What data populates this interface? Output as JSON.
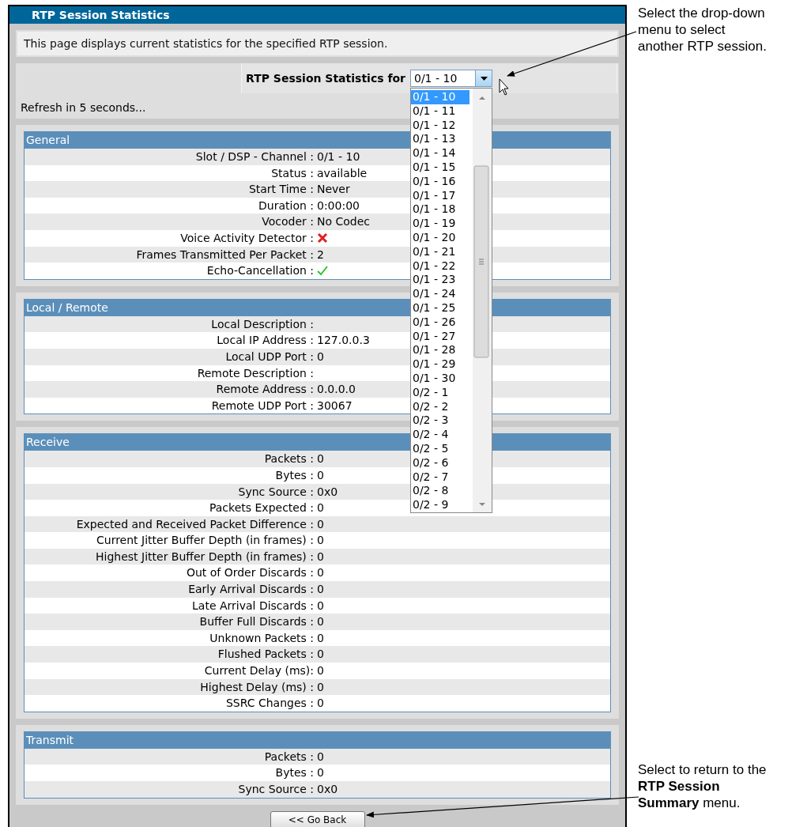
{
  "window": {
    "title": "RTP Session Statistics"
  },
  "description": "This page displays current statistics for the specified RTP session.",
  "session_selector": {
    "label": "RTP Session Statistics for",
    "value": "0/1 - 10",
    "expanded": true,
    "options": [
      {
        "label": "0/1 - 10",
        "selected": true
      },
      {
        "label": "0/1 - 11",
        "selected": false
      },
      {
        "label": "0/1 - 12",
        "selected": false
      },
      {
        "label": "0/1 - 13",
        "selected": false
      },
      {
        "label": "0/1 - 14",
        "selected": false
      },
      {
        "label": "0/1 - 15",
        "selected": false
      },
      {
        "label": "0/1 - 16",
        "selected": false
      },
      {
        "label": "0/1 - 17",
        "selected": false
      },
      {
        "label": "0/1 - 18",
        "selected": false
      },
      {
        "label": "0/1 - 19",
        "selected": false
      },
      {
        "label": "0/1 - 20",
        "selected": false
      },
      {
        "label": "0/1 - 21",
        "selected": false
      },
      {
        "label": "0/1 - 22",
        "selected": false
      },
      {
        "label": "0/1 - 23",
        "selected": false
      },
      {
        "label": "0/1 - 24",
        "selected": false
      },
      {
        "label": "0/1 - 25",
        "selected": false
      },
      {
        "label": "0/1 - 26",
        "selected": false
      },
      {
        "label": "0/1 - 27",
        "selected": false
      },
      {
        "label": "0/1 - 28",
        "selected": false
      },
      {
        "label": "0/1 - 29",
        "selected": false
      },
      {
        "label": "0/1 - 30",
        "selected": false
      },
      {
        "label": "0/2 - 1",
        "selected": false
      },
      {
        "label": "0/2 - 2",
        "selected": false
      },
      {
        "label": "0/2 - 3",
        "selected": false
      },
      {
        "label": "0/2 - 4",
        "selected": false
      },
      {
        "label": "0/2 - 5",
        "selected": false
      },
      {
        "label": "0/2 - 6",
        "selected": false
      },
      {
        "label": "0/2 - 7",
        "selected": false
      },
      {
        "label": "0/2 - 8",
        "selected": false
      },
      {
        "label": "0/2 - 9",
        "selected": false
      }
    ]
  },
  "refresh_text": "Refresh in 5 seconds...",
  "sections": [
    {
      "title": "General",
      "rows": [
        {
          "kind": "text",
          "label": "Slot / DSP - Channel :",
          "value": "0/1 - 10"
        },
        {
          "kind": "text",
          "label": "Status :",
          "value": "available"
        },
        {
          "kind": "text",
          "label": "Start Time :",
          "value": "Never"
        },
        {
          "kind": "text",
          "label": "Duration :",
          "value": "0:00:00"
        },
        {
          "kind": "text",
          "label": "Vocoder :",
          "value": "No Codec"
        },
        {
          "kind": "flag",
          "label": "Voice Activity Detector :",
          "on": false
        },
        {
          "kind": "text",
          "label": "Frames Transmitted Per Packet :",
          "value": "2"
        },
        {
          "kind": "flag",
          "label": "Echo-Cancellation :",
          "on": true
        }
      ]
    },
    {
      "title": "Local / Remote",
      "rows": [
        {
          "kind": "text",
          "label": "Local Description :"
        },
        {
          "kind": "text",
          "label": "Local IP Address :",
          "value": "127.0.0.3"
        },
        {
          "kind": "text",
          "label": "Local UDP Port :",
          "value": "0"
        },
        {
          "kind": "text",
          "label": "Remote Description :"
        },
        {
          "kind": "text",
          "label": "Remote Address :",
          "value": "0.0.0.0"
        },
        {
          "kind": "text",
          "label": "Remote UDP Port :",
          "value": "30067"
        }
      ]
    },
    {
      "title": "Receive",
      "rows": [
        {
          "kind": "text",
          "label": "Packets :",
          "value": "0"
        },
        {
          "kind": "text",
          "label": "Bytes :",
          "value": "0"
        },
        {
          "kind": "text",
          "label": "Sync Source :",
          "value": "0x0"
        },
        {
          "kind": "text",
          "label": "Packets Expected :",
          "value": "0"
        },
        {
          "kind": "text",
          "label": "Expected and Received Packet Difference :",
          "value": "0"
        },
        {
          "kind": "text",
          "label": "Current Jitter Buffer Depth (in frames) :",
          "value": "0"
        },
        {
          "kind": "text",
          "label": "Highest Jitter Buffer Depth (in frames) :",
          "value": "0"
        },
        {
          "kind": "text",
          "label": "Out of Order Discards :",
          "value": "0"
        },
        {
          "kind": "text",
          "label": "Early Arrival Discards :",
          "value": "0"
        },
        {
          "kind": "text",
          "label": "Late Arrival Discards :",
          "value": "0"
        },
        {
          "kind": "text",
          "label": "Buffer Full Discards :",
          "value": "0"
        },
        {
          "kind": "text",
          "label": "Unknown Packets :",
          "value": "0"
        },
        {
          "kind": "text",
          "label": "Flushed Packets :",
          "value": "0"
        },
        {
          "kind": "text",
          "label": "Current Delay (ms):",
          "value": "0"
        },
        {
          "kind": "text",
          "label": "Highest Delay (ms) :",
          "value": "0"
        },
        {
          "kind": "text",
          "label": "SSRC Changes :",
          "value": "0"
        }
      ]
    },
    {
      "title": "Transmit",
      "rows": [
        {
          "kind": "text",
          "label": "Packets :",
          "value": "0"
        },
        {
          "kind": "text",
          "label": "Bytes :",
          "value": "0"
        },
        {
          "kind": "text",
          "label": "Sync Source :",
          "value": "0x0"
        }
      ]
    }
  ],
  "back_button": "<< Go Back",
  "annotations": [
    {
      "text": "Select the drop-down menu to select another RTP session."
    },
    {
      "text": "Select to return to the **RTP Session Summary** menu."
    }
  ]
}
